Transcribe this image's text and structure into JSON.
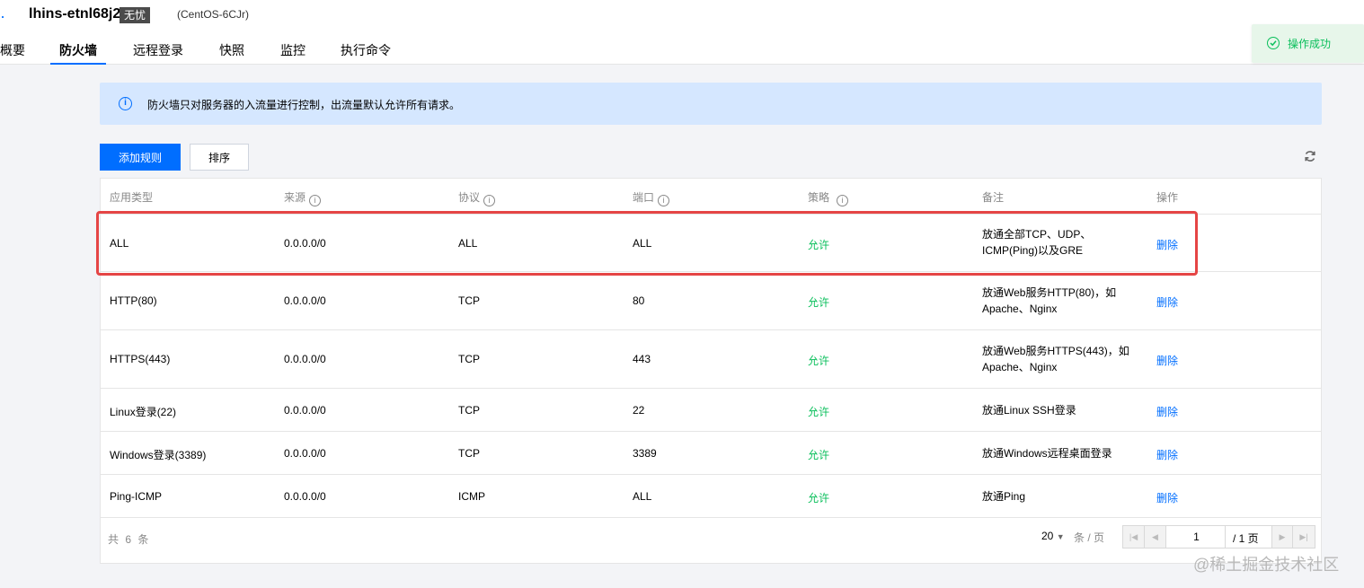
{
  "header": {
    "instance_name": "lhins-etnl68j2",
    "badge": "无忧",
    "os": "(CentOS-6CJr)"
  },
  "tabs": [
    "概要",
    "防火墙",
    "远程登录",
    "快照",
    "监控",
    "执行命令"
  ],
  "active_tab": "防火墙",
  "toast": {
    "text": "操作成功"
  },
  "notice": {
    "text": "防火墙只对服务器的入流量进行控制，出流量默认允许所有请求。"
  },
  "toolbar": {
    "add_rule": "添加规则",
    "sort": "排序"
  },
  "table": {
    "columns": [
      "应用类型",
      "来源",
      "协议",
      "端口",
      "策略",
      "备注",
      "操作"
    ],
    "rows": [
      {
        "app": "ALL",
        "source": "0.0.0.0/0",
        "protocol": "ALL",
        "port": "ALL",
        "policy": "允许",
        "remark": "放通全部TCP、UDP、ICMP(Ping)以及GRE",
        "action": "删除"
      },
      {
        "app": "HTTP(80)",
        "source": "0.0.0.0/0",
        "protocol": "TCP",
        "port": "80",
        "policy": "允许",
        "remark": "放通Web服务HTTP(80)，如Apache、Nginx",
        "action": "删除"
      },
      {
        "app": "HTTPS(443)",
        "source": "0.0.0.0/0",
        "protocol": "TCP",
        "port": "443",
        "policy": "允许",
        "remark": "放通Web服务HTTPS(443)，如Apache、Nginx",
        "action": "删除"
      },
      {
        "app": "Linux登录(22)",
        "source": "0.0.0.0/0",
        "protocol": "TCP",
        "port": "22",
        "policy": "允许",
        "remark": "放通Linux SSH登录",
        "action": "删除"
      },
      {
        "app": "Windows登录(3389)",
        "source": "0.0.0.0/0",
        "protocol": "TCP",
        "port": "3389",
        "policy": "允许",
        "remark": "放通Windows远程桌面登录",
        "action": "删除"
      },
      {
        "app": "Ping-ICMP",
        "source": "0.0.0.0/0",
        "protocol": "ICMP",
        "port": "ALL",
        "policy": "允许",
        "remark": "放通Ping",
        "action": "删除"
      }
    ]
  },
  "footer": {
    "total": "共 6 条",
    "page_size": "20",
    "page_size_unit": "条 / 页",
    "current_page": "1",
    "total_pages": "/ 1 页"
  },
  "watermark": "@稀土掘金技术社区",
  "colors": {
    "primary": "#006eff",
    "success": "#0abf5b",
    "highlight": "#e54545",
    "notice_bg": "#d5e7ff"
  }
}
